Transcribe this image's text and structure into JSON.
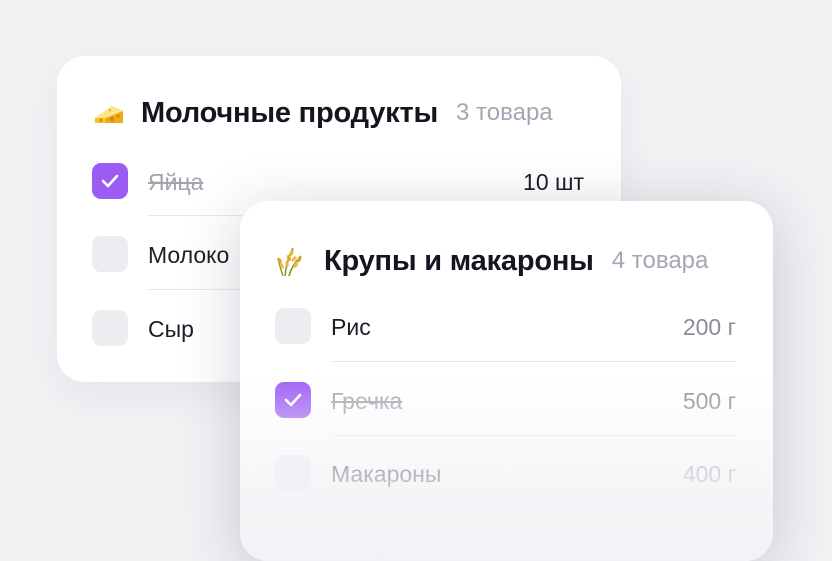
{
  "lists": [
    {
      "icon": "cheese-icon",
      "title": "Молочные продукты",
      "count": "3 товара",
      "items": [
        {
          "name": "Яйца",
          "qty": "10 шт",
          "checked": true
        },
        {
          "name": "Молоко",
          "qty": "",
          "checked": false
        },
        {
          "name": "Сыр",
          "qty": "",
          "checked": false
        }
      ]
    },
    {
      "icon": "rice-icon",
      "title": "Крупы и макароны",
      "count": "4 товара",
      "items": [
        {
          "name": "Рис",
          "qty": "200 г",
          "checked": false
        },
        {
          "name": "Гречка",
          "qty": "500 г",
          "checked": true
        },
        {
          "name": "Макароны",
          "qty": "400 г",
          "checked": false
        }
      ]
    }
  ],
  "colors": {
    "accent": "#9b5cf3",
    "checkbox_empty": "#ececf1",
    "background": "#f2f2f5"
  }
}
